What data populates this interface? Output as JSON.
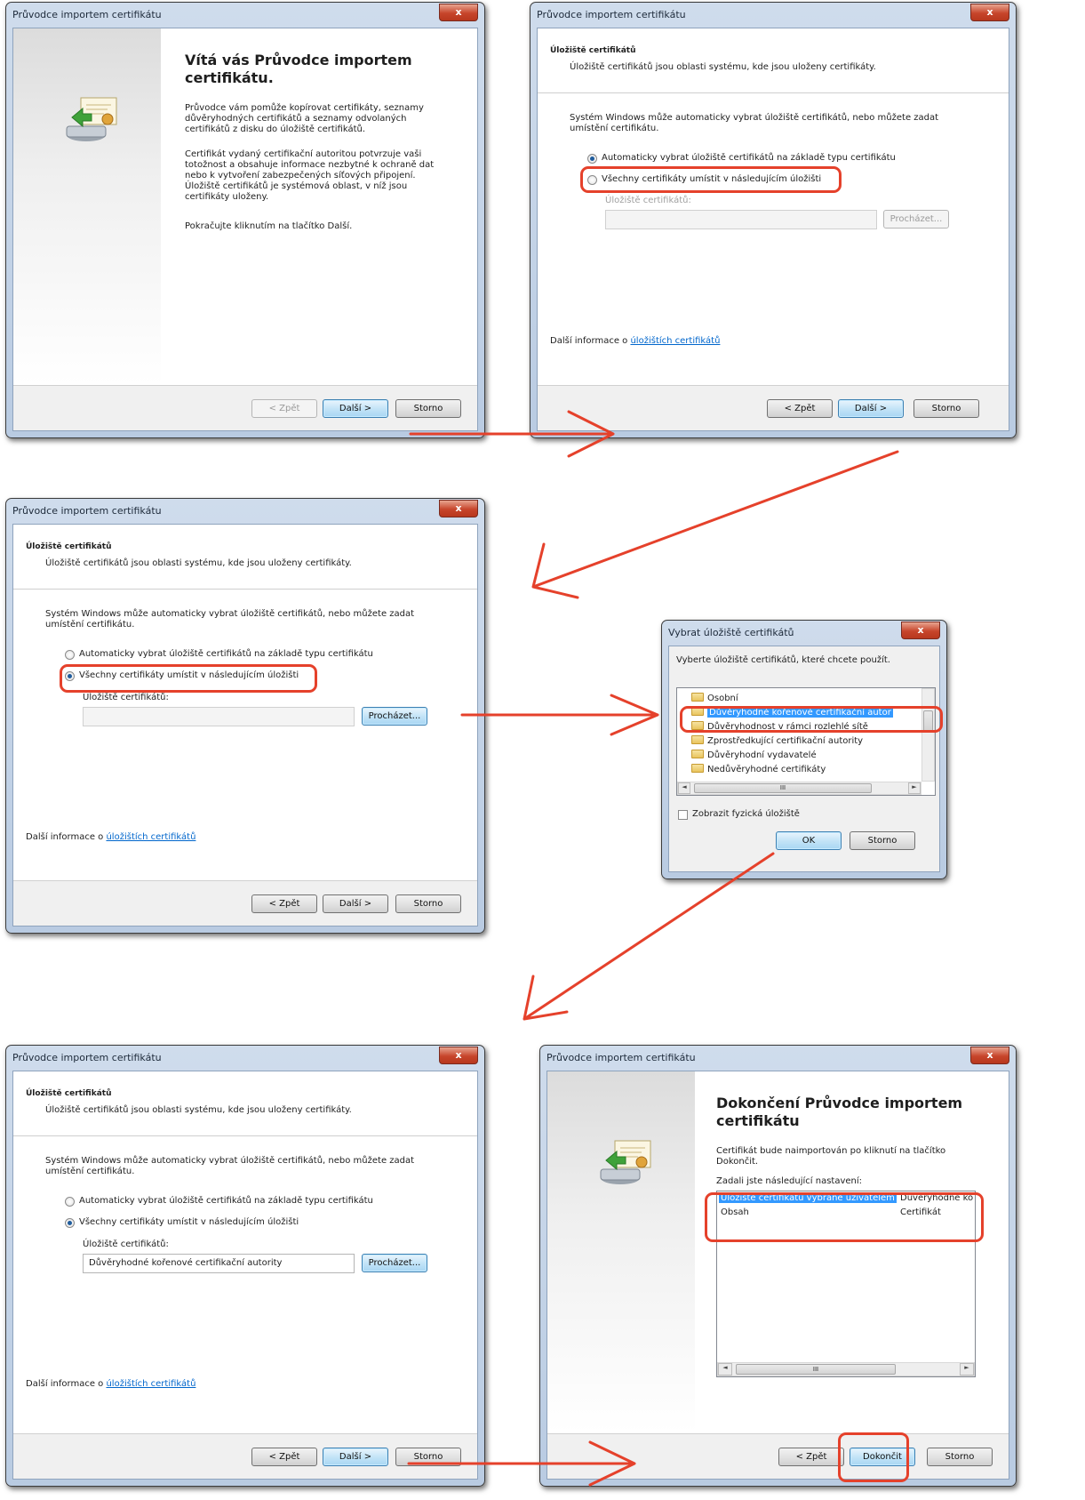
{
  "colors": {
    "highlight": "#e5412b",
    "link": "#0066cc",
    "selection": "#3399ff"
  },
  "wizard_title": "Průvodce importem certifikátu",
  "close_glyph": "x",
  "icons": {
    "cert": "certificate-import-icon",
    "folder": "folder-icon"
  },
  "store_header": {
    "title": "Úložiště certifikátů",
    "desc": "Úložiště certifikátů jsou oblasti systému, kde jsou uloženy certifikáty."
  },
  "store_body": {
    "intro": "Systém Windows může automaticky vybrat úložiště certifikátů, nebo můžete zadat umístění certifikátu.",
    "auto_option": "Automaticky vybrat úložiště certifikátů na základě typu certifikátu",
    "manual_option": "Všechny certifikáty umístit v následujícím úložišti",
    "store_label": "Úložiště certifikátů:",
    "browse": "Procházet...",
    "more_info_prefix": "Další informace o ",
    "more_info_link": "úložištích certifikátů"
  },
  "buttons": {
    "back": "< Zpět",
    "next": "Další >",
    "cancel": "Storno",
    "finish": "Dokončit",
    "ok": "OK"
  },
  "step1": {
    "heading": "Vítá vás Průvodce importem certifikátu.",
    "para1": "Průvodce vám pomůže kopírovat certifikáty, seznamy důvěryhodných certifikátů a seznamy odvolaných certifikátů z disku do úložiště certifikátů.",
    "para2": "Certifikát vydaný certifikační autoritou potvrzuje vaši totožnost a obsahuje informace nezbytné k ochraně dat nebo k vytvoření zabezpečených síťových připojení. Úložiště certifikátů je systémová oblast, v níž jsou certifikáty uloženy.",
    "para3": "Pokračujte kliknutím na tlačítko Další."
  },
  "step4": {
    "store_value": "Důvěryhodné kořenové certifikační autority"
  },
  "select_store": {
    "title": "Vybrat úložiště certifikátů",
    "prompt": "Vyberte úložiště certifikátů, které chcete použít.",
    "items": [
      "Osobní",
      "Důvěryhodné kořenové certifikační autor",
      "Důvěryhodnost v rámci rozlehlé sítě",
      "Zprostředkující certifikační autority",
      "Důvěryhodní vydavatelé",
      "Nedůvěryhodné certifikáty"
    ],
    "selected_index": 1,
    "hscroll_grip": "III",
    "show_physical": "Zobrazit fyzická úložiště"
  },
  "finish": {
    "heading": "Dokončení Průvodce importem certifikátu",
    "para": "Certifikát bude naimportován po kliknutí na tlačítko Dokončit.",
    "settings_label": "Zadali jste následující nastavení:",
    "rows": [
      {
        "key": "Úložiště certifikátů vybrané uživatelem",
        "value": "Důvěryhodné kořenov"
      },
      {
        "key": "Obsah",
        "value": "Certifikát"
      }
    ],
    "hscroll_grip": "III"
  }
}
